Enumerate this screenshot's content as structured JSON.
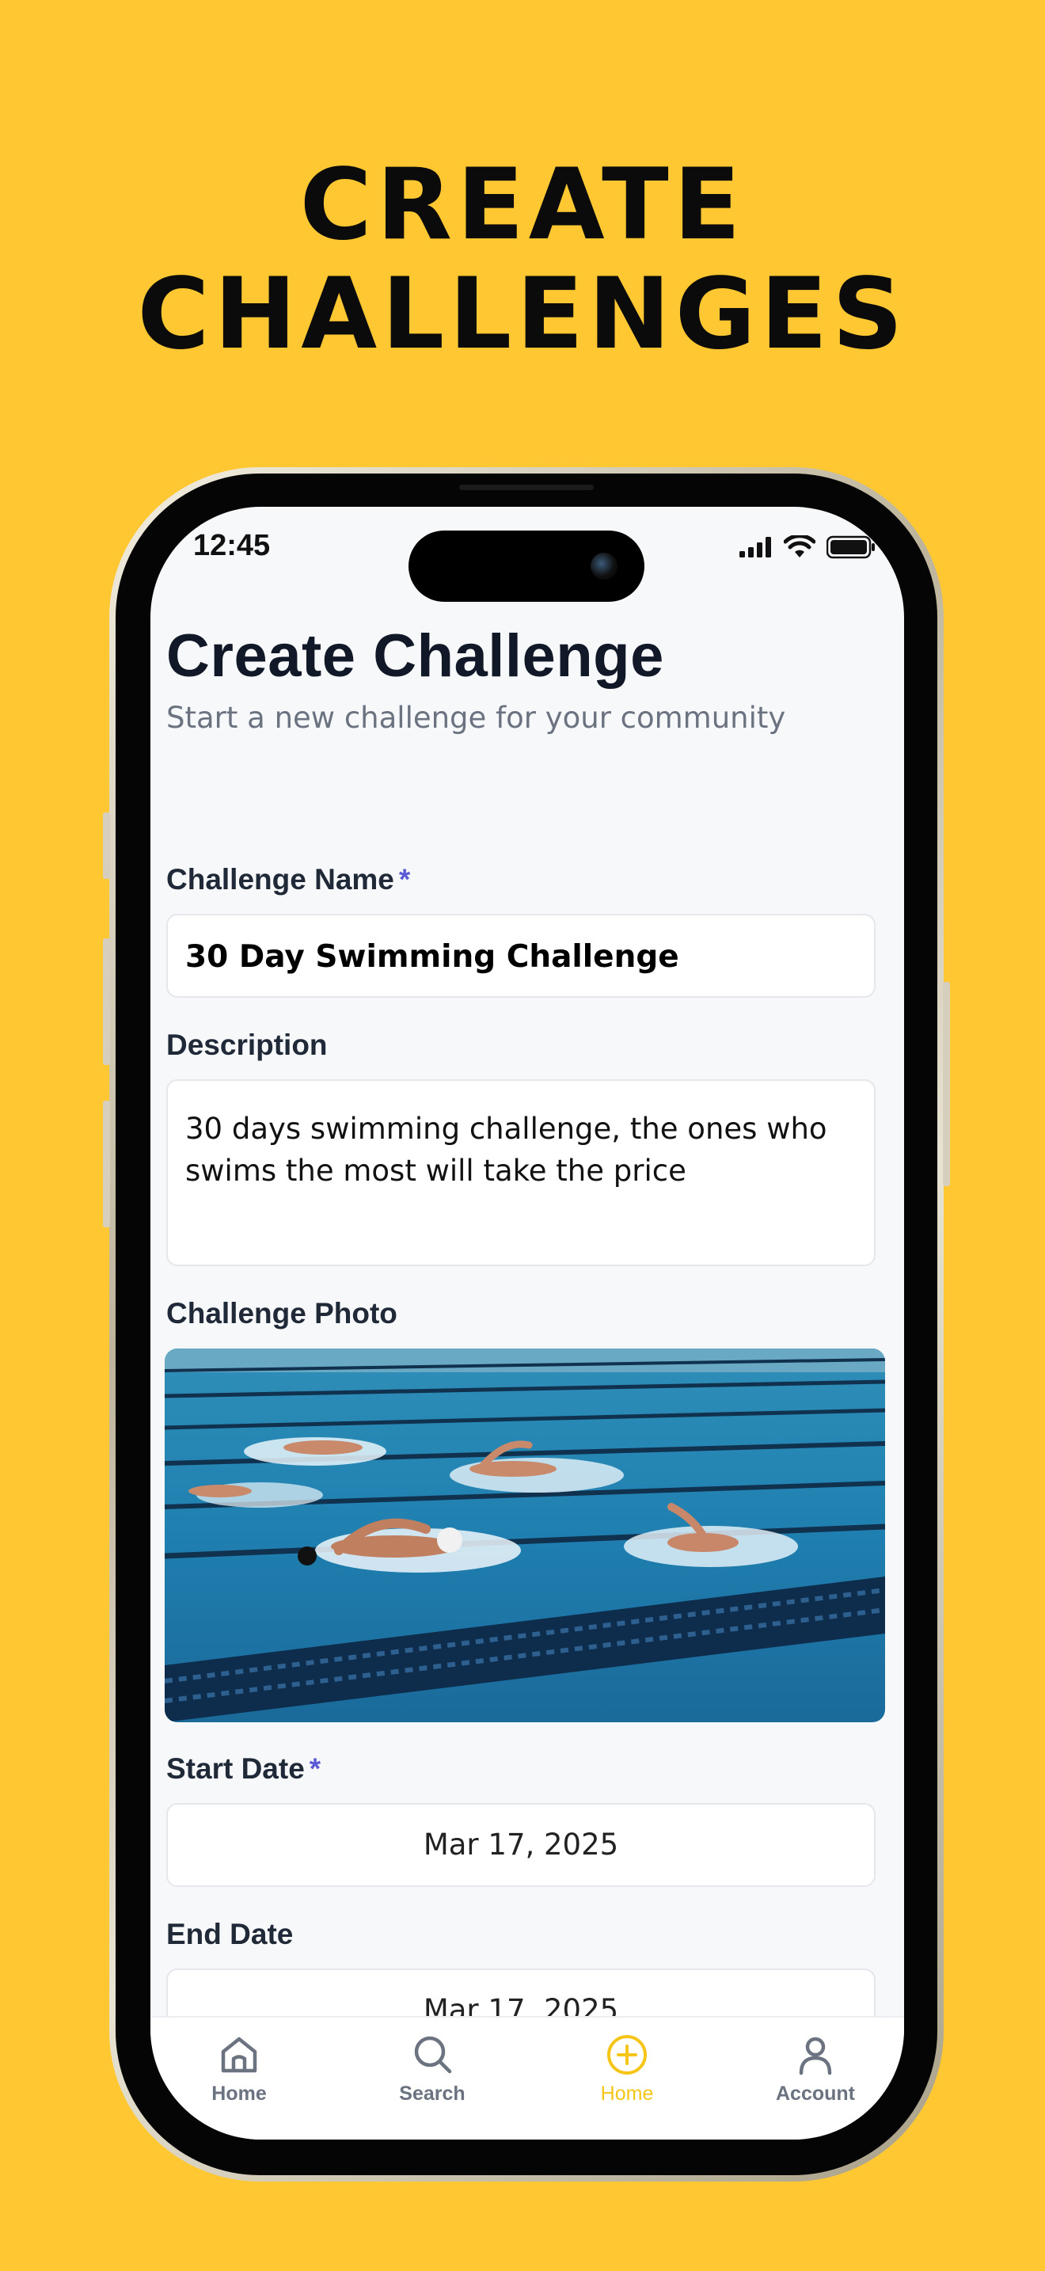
{
  "headline": {
    "line1": "CREATE",
    "line2": "CHALLENGES"
  },
  "status_bar": {
    "time": "12:45",
    "icons": [
      "signal-icon",
      "wifi-icon",
      "battery-icon"
    ]
  },
  "page": {
    "title": "Create Challenge",
    "subtitle": "Start a new challenge for your community"
  },
  "form": {
    "name_label": "Challenge Name",
    "required_mark": "*",
    "name_value": "30 Day Swimming Challenge",
    "description_label": "Description",
    "description_value": "30 days swimming challenge, the ones who swims the most will take the price",
    "photo_label": "Challenge Photo",
    "start_label": "Start Date",
    "start_value": "Mar 17, 2025",
    "end_label": "End Date",
    "end_value": "Mar 17, 2025"
  },
  "tabbar": {
    "items": [
      {
        "label": "Home",
        "icon": "home-icon",
        "active": false
      },
      {
        "label": "Search",
        "icon": "search-icon",
        "active": false
      },
      {
        "label": "Home",
        "icon": "plus-circle-icon",
        "active": true
      },
      {
        "label": "Account",
        "icon": "user-icon",
        "active": false
      }
    ]
  },
  "colors": {
    "background": "#FFC832",
    "accent": "#F5C518",
    "required": "#5B5BD6",
    "title": "#111827"
  }
}
